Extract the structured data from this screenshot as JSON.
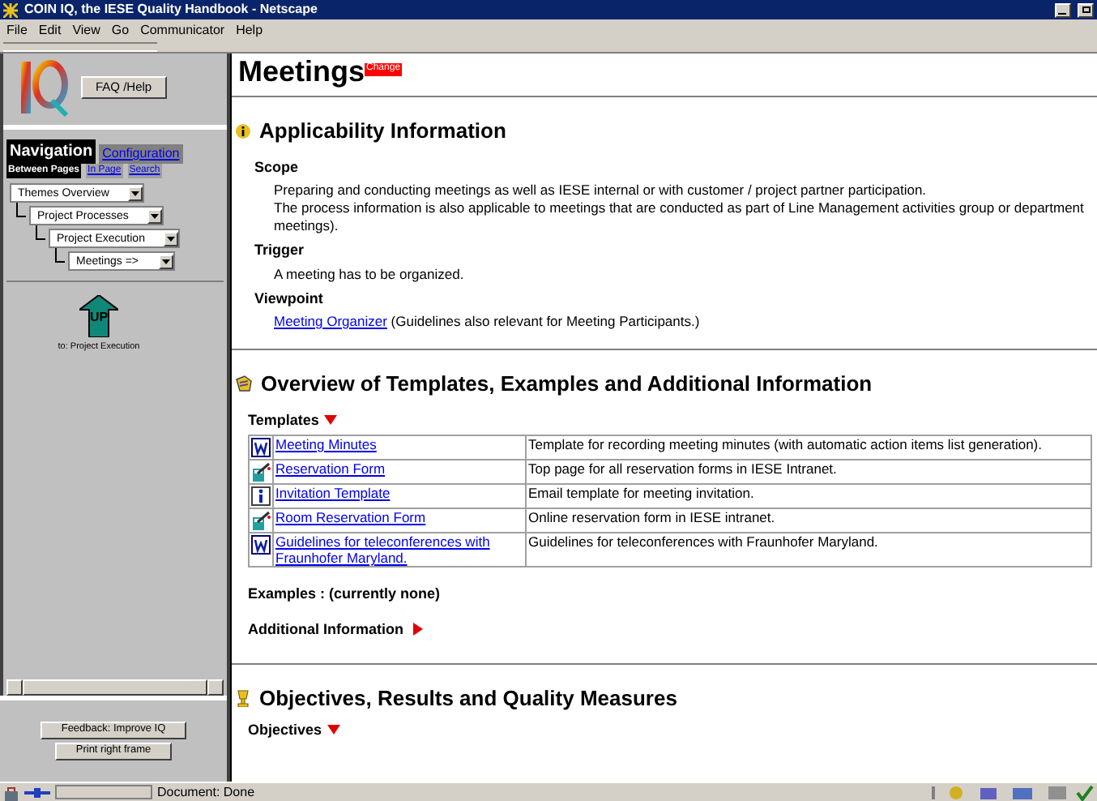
{
  "window": {
    "title": "COIN IQ, the IESE Quality Handbook - Netscape"
  },
  "menu": [
    "File",
    "Edit",
    "View",
    "Go",
    "Communicator",
    "Help"
  ],
  "sidebar": {
    "faq_button": "FAQ /Help",
    "tabs": [
      {
        "label": "Navigation",
        "selected": true
      },
      {
        "label": "Configuration",
        "selected": false
      }
    ],
    "subtabs": [
      {
        "label": "Between Pages",
        "selected": true
      },
      {
        "label": "In Page",
        "selected": false
      },
      {
        "label": "Search",
        "selected": false
      }
    ],
    "dropdown": {
      "value": "Themes Overview",
      "children": [
        {
          "value": "Project Processes",
          "children": [
            {
              "value": "Project Execution",
              "children": [
                {
                  "value": "Meetings =>"
                }
              ]
            }
          ]
        }
      ]
    },
    "up_button": "UP",
    "up_caption": "to: Project Execution",
    "buttons": [
      "Feedback: Improve IQ",
      "Print right frame"
    ]
  },
  "page": {
    "title": "Meetings",
    "badge": "Change",
    "applicability": {
      "heading": "Applicability Information",
      "items": [
        {
          "label": "Scope",
          "lines": [
            "Preparing and conducting meetings as well as IESE internal or with customer / project partner participation.",
            "The process information is also applicable to meetings that are conducted as part of Line Management activities group or department meetings)."
          ]
        },
        {
          "label": "Trigger",
          "lines": [
            "A meeting has to be organized."
          ]
        },
        {
          "label": "Viewpoint",
          "link": "Meeting Organizer",
          "note": " (Guidelines also relevant for Meeting Participants.)"
        }
      ]
    },
    "overview": {
      "heading": "Overview of Templates, Examples and Additional Information",
      "templates_label": "Templates",
      "templates_expanded": true,
      "templates": [
        {
          "kind": "word",
          "name": "Meeting Minutes",
          "description": "Template for recording meeting minutes (with automatic action items list generation)."
        },
        {
          "kind": "form",
          "name": "Reservation Form ",
          "description": "Top page for all reservation forms in IESE Intranet."
        },
        {
          "kind": "info",
          "name": "Invitation Template ",
          "description": "Email template for meeting invitation."
        },
        {
          "kind": "form",
          "name": "Room Reservation Form ",
          "description": "Online reservation form in IESE intranet."
        },
        {
          "kind": "word",
          "name": "Guidelines for teleconferences with Fraunhofer Maryland.",
          "description": "Guidelines for teleconferences with Fraunhofer Maryland."
        }
      ],
      "examples": "Examples : (currently none)",
      "additional": "Additional Information",
      "additional_expanded": false
    },
    "objectives": {
      "heading": "Objectives, Results and Quality Measures",
      "sub": "Objectives",
      "expanded": true
    }
  },
  "status_bar": {
    "text": "Document: Done"
  }
}
